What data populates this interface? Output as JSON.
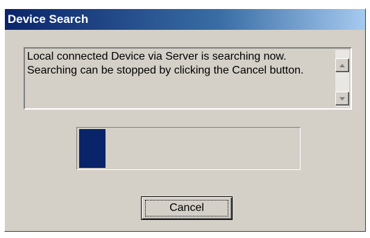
{
  "window": {
    "title": "Device Search"
  },
  "message": {
    "text": "Local connected Device via Server is searching now. Searching can be stopped by clicking the Cancel button."
  },
  "scrollbar": {
    "up_icon": "scroll-up-arrow-icon",
    "down_icon": "scroll-down-arrow-icon"
  },
  "progress": {
    "fraction": 0.12,
    "fill_color": "#0a246a"
  },
  "buttons": {
    "cancel_label": "Cancel"
  }
}
